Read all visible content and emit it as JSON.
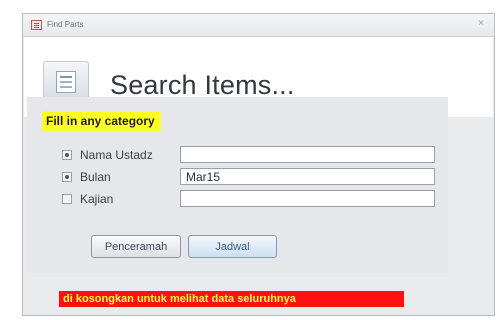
{
  "window": {
    "title": "Find Parts",
    "close_symbol": "×"
  },
  "header": {
    "title": "Search Items...",
    "icon": "form-icon"
  },
  "form": {
    "hint_top": "Fill in any category",
    "rows": [
      {
        "label": "Nama Ustadz",
        "value": "",
        "selected": true
      },
      {
        "label": "Bulan",
        "value": "Mar15",
        "selected": true
      },
      {
        "label": "Kajian",
        "value": "",
        "selected": false
      }
    ],
    "buttons": {
      "penceramah": "Penceramah",
      "jadwal": "Jadwal"
    },
    "hint_bottom": "di kosongkan untuk melihat data seluruhnya"
  },
  "colors": {
    "hint_top_bg": "#ffff22",
    "hint_bottom_bg": "#ff1111",
    "hint_bottom_text": "#ffff44"
  }
}
